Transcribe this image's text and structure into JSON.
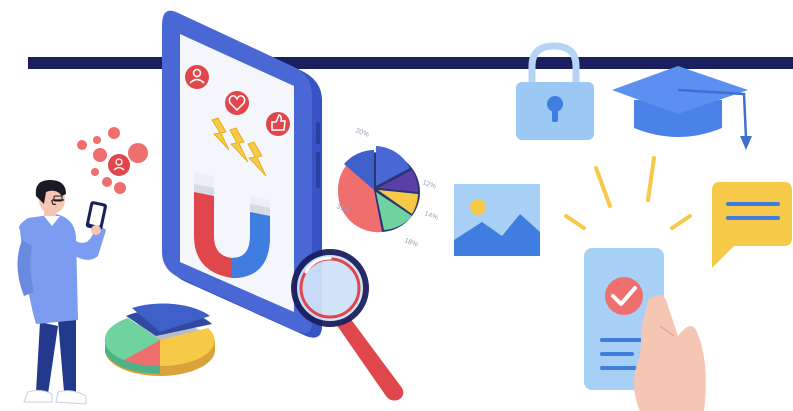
{
  "illustration": {
    "pie_labels": [
      "20%",
      "12%",
      "14%",
      "18%",
      "31%"
    ],
    "colors": {
      "navy": "#1b1f5e",
      "phone": "#4a67d6",
      "coral": "#ef6e6e",
      "red": "#e0474c",
      "blue": "#3f7ee0",
      "light_blue": "#9cc8f4",
      "yellow": "#f7c948",
      "green": "#6fd3a0",
      "skin": "#f5c6b3"
    },
    "icons": [
      "user-icon",
      "heart-icon",
      "thumbs-up-icon",
      "magnet-icon",
      "lightning-icon",
      "magnifier-icon",
      "pie-chart-icon",
      "lock-icon",
      "graduation-cap-icon",
      "image-icon",
      "chat-bubble-icon",
      "checkmark-icon",
      "smartphone-icon"
    ]
  }
}
